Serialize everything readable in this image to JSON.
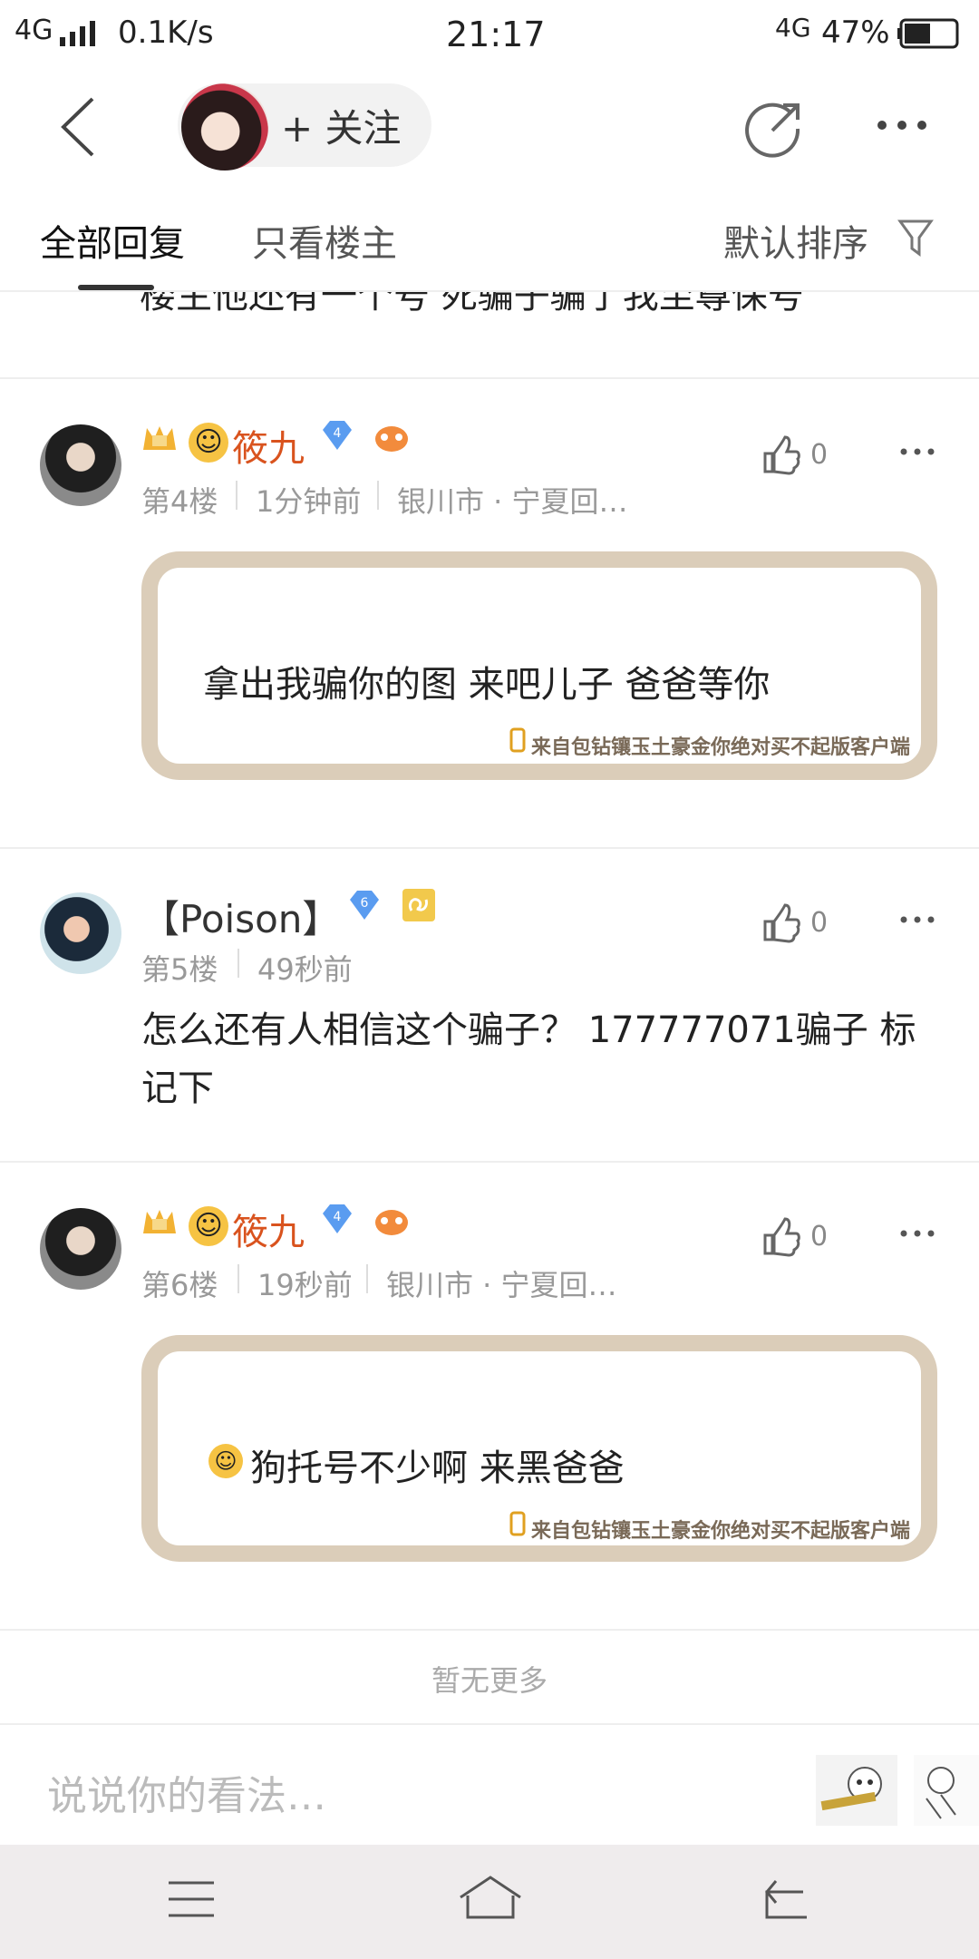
{
  "status_bar": {
    "network_left": "4G",
    "speed": "0.1K/s",
    "time": "21:17",
    "network_right": "4G",
    "battery": "47%"
  },
  "header": {
    "follow_label": "+ 关注"
  },
  "tabs": {
    "all_replies": "全部回复",
    "op_only": "只看楼主",
    "sort": "默认排序"
  },
  "clipped_text": "楼主他还有一个号 死骗子骗了我至尊保号",
  "posts": [
    {
      "name": "筱九",
      "level": "4",
      "floor": "第4楼",
      "time": "1分钟前",
      "location": "银川市 · 宁夏回…",
      "likes": "0",
      "text": "拿出我骗你的图 来吧儿子 爸爸等你",
      "source": "来自包钻镶玉土豪金你绝对买不起版客户端"
    },
    {
      "name": "【Poison】",
      "level": "6",
      "floor": "第5楼",
      "time": "49秒前",
      "likes": "0",
      "text": "怎么还有人相信这个骗子？ 177777071骗子 标记下"
    },
    {
      "name": "筱九",
      "level": "4",
      "floor": "第6楼",
      "time": "19秒前",
      "location": "银川市 · 宁夏回…",
      "likes": "0",
      "text": "狗托号不少啊 来黑爸爸",
      "source": "来自包钻镶玉土豪金你绝对买不起版客户端"
    }
  ],
  "no_more": "暂无更多",
  "input": {
    "placeholder": "说说你的看法…"
  },
  "icons": {
    "back": "chevron-left-icon",
    "share": "share-icon",
    "more": "more-dots-icon",
    "filter": "filter-icon",
    "like": "thumbs-up-icon",
    "menu": "menu-icon",
    "home": "home-icon",
    "return": "back-icon"
  },
  "colors": {
    "name_accent": "#d9531e",
    "frame": "#dbcdb9",
    "badge_blue": "#5a9cf0"
  }
}
